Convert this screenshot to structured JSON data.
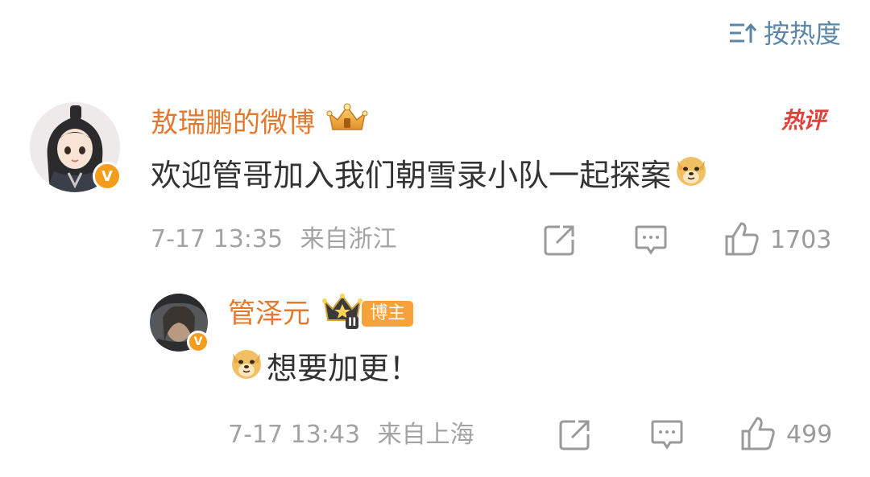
{
  "sort": {
    "icon": "sort-icon",
    "label": "按热度"
  },
  "comments": [
    {
      "username": "敖瑞鹏的微博",
      "crown_icon": "gold-crown-icon",
      "verified_badge": "V",
      "hot_tag": "热评",
      "text": "欢迎管哥加入我们朝雪录小队一起探案",
      "emoji": "doge-emoji-icon",
      "time": "7-17 13:35",
      "location": "来自浙江",
      "likes": "1703"
    },
    {
      "username": "管泽元",
      "crown_icon": "crown-level-icon",
      "crown_level": "II",
      "verified_badge": "V",
      "author_tag": "博主",
      "emoji": "doge-emoji-icon",
      "text": "想要加更！",
      "time": "7-17 13:43",
      "location": "来自上海",
      "likes": "499"
    }
  ],
  "colors": {
    "username": "#e3792e",
    "meta": "#a3a3a3",
    "sort": "#5b86a8",
    "hot": "#e0413c",
    "blogger_tag": "#f7a13b",
    "verified": "#f59c1a"
  }
}
